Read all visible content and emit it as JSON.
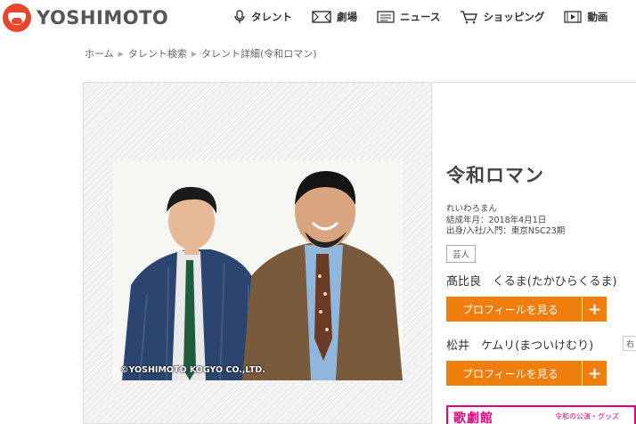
{
  "header": {
    "logo_text": "YOSHIMOTO",
    "nav": [
      {
        "label": "タレント",
        "icon": "microphone-icon"
      },
      {
        "label": "劇場",
        "icon": "theater-icon"
      },
      {
        "label": "ニュース",
        "icon": "news-icon"
      },
      {
        "label": "ショッピング",
        "icon": "cart-icon"
      },
      {
        "label": "動画",
        "icon": "video-icon"
      }
    ]
  },
  "breadcrumb": [
    "ホーム",
    "タレント検索",
    "タレント詳細(令和ロマン)"
  ],
  "photo": {
    "copyright": "©YOSHIMOTO KOGYO CO.,LTD."
  },
  "profile": {
    "name": "令和ロマン",
    "reading": "れいわろまん",
    "formed": "結成年月：2018年4月1日",
    "origin": "出身/入社/入門：東京NSC23期",
    "tag": "芸人",
    "members": [
      {
        "name": "髙比良　くるま(たかひらくるま)",
        "button": "プロフィールを見る",
        "tail": ""
      },
      {
        "name": "松井　ケムリ(まついけむり)",
        "button": "プロフィールを見る",
        "tail": "右"
      }
    ]
  },
  "promo": {
    "text": "歌劇館",
    "small": "令和の公演・グッズ"
  },
  "colors": {
    "brand": "#e8462c",
    "button": "#f07e0c",
    "promo": "#e6007e"
  }
}
